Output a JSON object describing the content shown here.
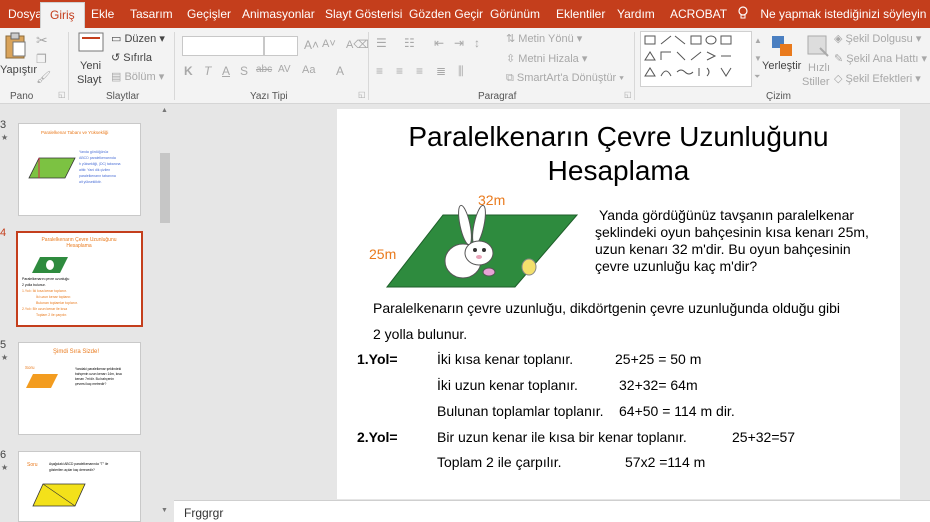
{
  "tabs": [
    "Dosya",
    "Giriş",
    "Ekle",
    "Tasarım",
    "Geçişler",
    "Animasyonlar",
    "Slayt Gösterisi",
    "Gözden Geçir",
    "Görünüm",
    "Eklentiler",
    "Yardım",
    "ACROBAT"
  ],
  "tell_me": "Ne yapmak istediğinizi söyleyin",
  "ribbon": {
    "paste": "Yapıştır",
    "new_slide_1": "Yeni",
    "new_slide_2": "Slayt",
    "layout": "Düzen",
    "reset": "Sıfırla",
    "section": "Bölüm",
    "font_buttons": [
      "K",
      "T",
      "A",
      "S",
      "AV",
      "Aa",
      "A"
    ],
    "text_direction": "Metin Yönü",
    "align_text": "Metni Hizala",
    "smartart": "SmartArt'a Dönüştür",
    "arrange": "Yerleştir",
    "quick_styles_1": "Hızlı",
    "quick_styles_2": "Stiller",
    "shape_fill": "Şekil Dolgusu",
    "shape_outline": "Şekil Ana Hattı",
    "shape_effects": "Şekil Efektleri",
    "groups": {
      "clipboard": "Pano",
      "slides": "Slaytlar",
      "font": "Yazı Tipi",
      "paragraph": "Paragraf",
      "drawing": "Çizim"
    }
  },
  "thumbnails": [
    {
      "num": "3",
      "title": "Paralelkenar Tabanı ve Yüksekliği",
      "lines": [
        "Yanda gördüğünüz",
        "ABCD paralelkenarında",
        "h yüksekliği, |DC| tabanına",
        "aittir. Yani dik çizilen",
        "paralelkenarın tabanına",
        "ait yüksekliktir."
      ]
    },
    {
      "num": "4",
      "title": "Paralelkenarın Çevre Uzunluğunu Hesaplama",
      "lines": [
        "Paralelkenarın çevre uzunluğu",
        "2 yolla bulunur.",
        "1.Yol=  İki kısa kenar toplanır.",
        "İki uzun kenar toplanır.",
        "Bulunan toplamlar toplanır.",
        "2.Yol=  Bir uzun kenar ile kısa",
        "Toplam 2 ile çarpılır."
      ]
    },
    {
      "num": "5",
      "title": "Şimdi Sıra Sizde!",
      "label": "Soru",
      "lines": [
        "Yandaki paralelkenar şeklindeki",
        "bahçenin uzun kenarı 14m, kısa",
        "kenarı 7m'dir. Bu bahçenin",
        "çevresi kaç metredir?"
      ]
    },
    {
      "num": "6",
      "label": "Soru",
      "lines": [
        "Aşağıdaki ABCD paralelkenarında \"T\" ile",
        "gösterilen açılar kaç derecedir?"
      ]
    }
  ],
  "slide": {
    "title_1": "Paralelkenarın Çevre Uzunluğunu",
    "title_2": "Hesaplama",
    "label_long": "32m",
    "label_short": "25m",
    "problem": [
      "Yanda gördüğünüz tavşanın paralelkenar",
      "şeklindeki oyun bahçesinin kısa kenarı 25m,",
      "uzun kenarı 32 m'dir. Bu oyun bahçesinin",
      "çevre uzunluğu kaç m'dir?"
    ],
    "intro_1": "Paralelkenarın çevre uzunluğu, dikdörtgenin çevre uzunluğunda olduğu gibi",
    "intro_2": "2 yolla  bulunur.",
    "way1": "1.Yol=",
    "way2": "2.Yol=",
    "steps1": [
      {
        "text": "İki kısa kenar toplanır.",
        "calc": "25+25 = 50 m"
      },
      {
        "text": "İki uzun kenar toplanır.",
        "calc": "32+32= 64m"
      },
      {
        "text": "Bulunan toplamlar toplanır.",
        "calc": "64+50 = 114 m dir."
      }
    ],
    "steps2": [
      {
        "text": "Bir uzun kenar ile kısa bir kenar toplanır.",
        "calc": "25+32=57"
      },
      {
        "text": "Toplam 2 ile çarpılır.",
        "calc": "57x2 =114 m"
      }
    ]
  },
  "notes": "Frggrgr",
  "colors": {
    "accent": "#c43e1c",
    "orange": "#e97a1d",
    "green": "#2e8b3e"
  }
}
